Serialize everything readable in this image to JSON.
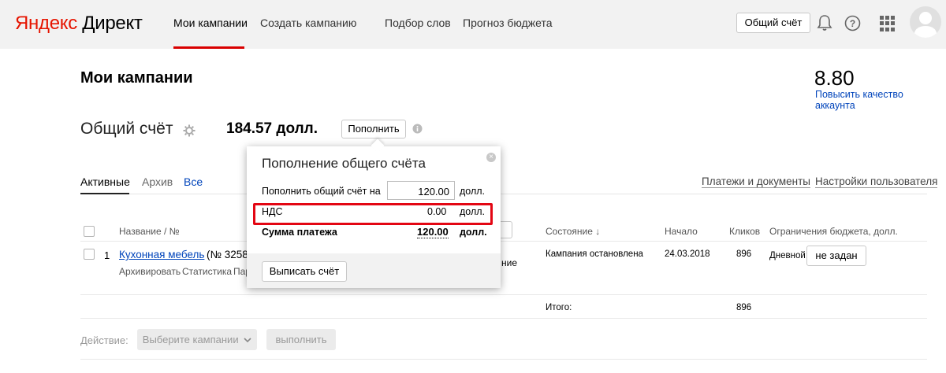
{
  "header": {
    "logo_part1": "Яндекс",
    "logo_part2": " Директ",
    "nav": [
      "Мои кампании",
      "Создать кампанию",
      "Подбор слов",
      "Прогноз бюджета"
    ],
    "shared_account_button": "Общий счёт"
  },
  "page": {
    "title": "Мои кампании",
    "quality_score": "8.80",
    "quality_link": "Повысить качество аккаунта"
  },
  "account": {
    "title": "Общий счёт",
    "sum": "184.57 долл.",
    "topup_button": "Пополнить"
  },
  "tabs": [
    "Активные",
    "Архив",
    "Все"
  ],
  "top_links": [
    "Платежи и документы",
    "Настройки пользователя"
  ],
  "table": {
    "headers": {
      "name": "Название / №",
      "state": "Состояние ↓",
      "start": "Начало",
      "clicks": "Кликов",
      "budget": "Ограничения бюджета, долл."
    },
    "rows": [
      {
        "num": "1",
        "name": "Кухонная мебель",
        "id_text": "(№ 3258",
        "actions": [
          "Архивировать",
          "Статистика",
          "Пар"
        ],
        "obscured_tail": "ние",
        "state": "Кампания остановлена",
        "start": "24.03.2018",
        "clicks": "896",
        "budget_label": "Дневной:",
        "budget_value": "не задан"
      }
    ],
    "total_label": "Итого:",
    "total_clicks": "896"
  },
  "actions_bar": {
    "label": "Действие:",
    "select": "Выберите кампании",
    "run": "выполнить"
  },
  "popup": {
    "title": "Пополнение общего счёта",
    "amount_label": "Пополнить общий счёт на",
    "amount_value": "120.00",
    "currency": "долл.",
    "vat_label": "НДС",
    "vat_value": "0.00",
    "total_label": "Сумма платежа",
    "total_value": "120.00",
    "invoice_button": "Выписать счёт"
  },
  "colors": {
    "header_bg": "#f2f2f2",
    "brand_red": "#e61400",
    "link": "#0044bb",
    "highlight": "#e30613"
  }
}
